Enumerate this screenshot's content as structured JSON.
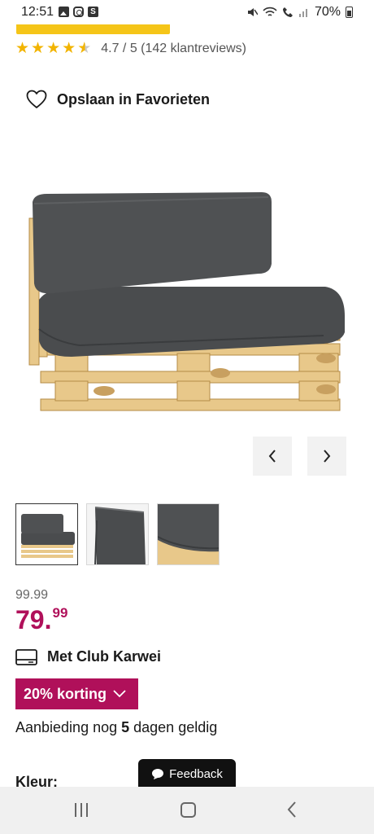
{
  "status_bar": {
    "time": "12:51",
    "battery": "70%"
  },
  "rating": {
    "value": 4.7,
    "max": 5,
    "text": "4.7 / 5 (142 klantreviews)",
    "star_color": "#f2b400"
  },
  "favorite": {
    "label": "Opslaan in Favorieten",
    "icon": "heart-outline-icon"
  },
  "gallery": {
    "prev_icon": "chevron-left-icon",
    "next_icon": "chevron-right-icon",
    "thumbnails": [
      "pallet-sofa-thumbnail",
      "cushion-edge-thumbnail",
      "cushion-corner-thumbnail"
    ],
    "active_thumbnail": 0
  },
  "price": {
    "old": "99.99",
    "new_int": "79.",
    "new_dec": "99",
    "color": "#b0105a"
  },
  "club": {
    "label": "Met Club Karwei",
    "icon": "card-icon"
  },
  "discount": {
    "label": "20% korting",
    "icon": "chevron-down-icon",
    "color": "#b0105a"
  },
  "offer": {
    "prefix": "Aanbieding nog ",
    "days": "5",
    "suffix": " dagen geldig"
  },
  "kleur": {
    "label": "Kleur:"
  },
  "feedback": {
    "label": "Feedback",
    "icon": "chat-bubble-icon"
  },
  "nav_bar": {
    "items": [
      "recent-apps",
      "home",
      "back"
    ]
  }
}
